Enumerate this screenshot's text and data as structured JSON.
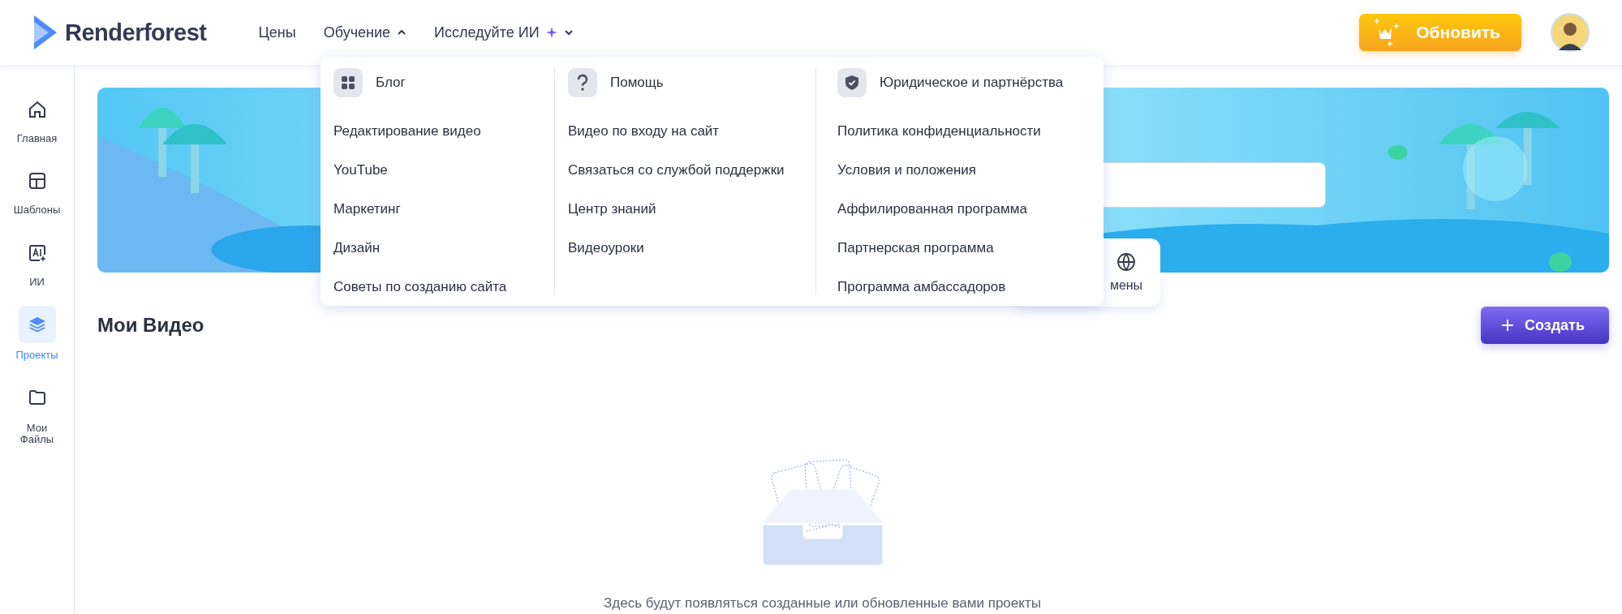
{
  "logo": {
    "text": "Renderforest"
  },
  "nav": [
    {
      "label": "Цены",
      "kind": "link"
    },
    {
      "label": "Обучение",
      "kind": "dropdown",
      "expanded": true
    },
    {
      "label": "Исследуйте ИИ",
      "kind": "ai",
      "expanded": false
    }
  ],
  "upgrade_button": {
    "label": "Обновить"
  },
  "sidebar": {
    "items": [
      {
        "label": "Главная",
        "kind": "home",
        "selected": false
      },
      {
        "label": "Шаблоны",
        "kind": "templates",
        "selected": false
      },
      {
        "label": "ИИ",
        "kind": "ai",
        "selected": false
      },
      {
        "label": "Проекты",
        "kind": "projects",
        "selected": true
      },
      {
        "label": "Мои Файлы",
        "kind": "files",
        "selected": false
      }
    ]
  },
  "banner": {
    "card_text": "мены"
  },
  "dropdown": {
    "columns": [
      {
        "title": "Блог",
        "kind": "grid",
        "links": [
          "Редактирование видео",
          "YouTube",
          "Маркетинг",
          "Дизайн",
          "Советы по созданию сайта"
        ]
      },
      {
        "title": "Помощь",
        "kind": "help",
        "links": [
          "Видео по входу на сайт",
          "Связаться со службой поддержки",
          "Центр знаний",
          "Видеоуроки"
        ]
      },
      {
        "title": "Юридическое и партнёрства",
        "kind": "shield",
        "links": [
          "Политика конфиденциальности",
          "Условия и положения",
          "Аффилированная программа",
          "Партнерская программа",
          "Программа амбассадоров"
        ]
      }
    ]
  },
  "section": {
    "title": "Мои Видео",
    "create_button": "Создать"
  },
  "empty_state": {
    "message": "Здесь будут появляться созданные или обновленные вами проекты"
  }
}
